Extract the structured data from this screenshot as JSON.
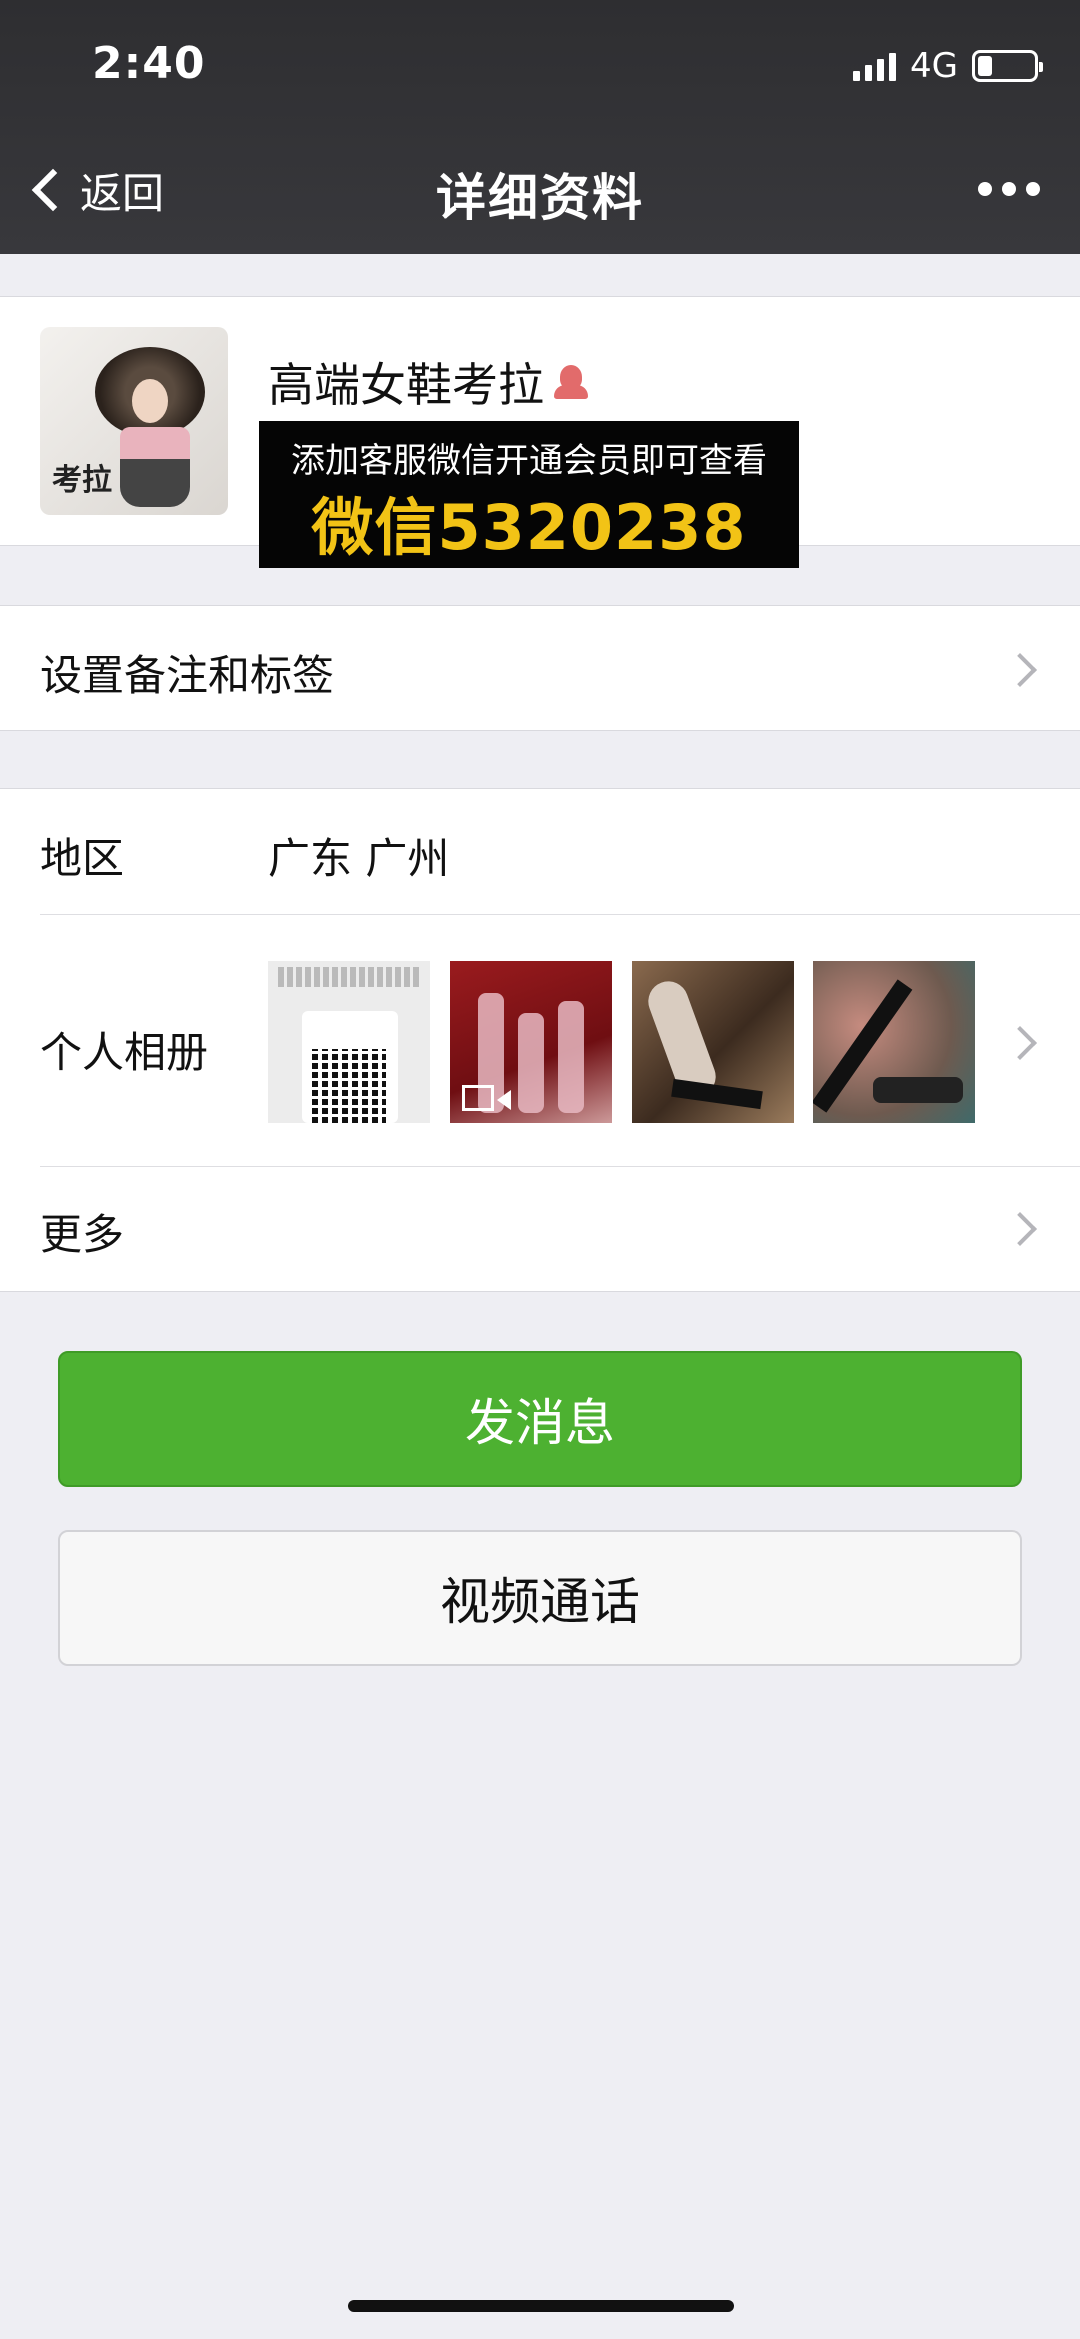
{
  "status_bar": {
    "time": "2:40",
    "network": "4G",
    "signal_bars": 4,
    "battery_level": 0.25
  },
  "nav": {
    "back_label": "返回",
    "title": "详细资料",
    "more_icon": "more-dots-icon"
  },
  "profile": {
    "name": "高端女鞋考拉",
    "avatar_text": "考拉",
    "gender_icon": "female-icon"
  },
  "promo": {
    "line1": "添加客服微信开通会员即可查看",
    "line2": "微信5320238"
  },
  "rows": {
    "remark_label": "设置备注和标签",
    "region_label": "地区",
    "region_value": "广东 广州",
    "album_label": "个人相册",
    "more_label": "更多"
  },
  "buttons": {
    "send_message": "发消息",
    "video_call": "视频通话"
  },
  "colors": {
    "header_bg": "#333336",
    "primary_green": "#4db131",
    "promo_yellow": "#f2c316",
    "page_bg": "#eeeef3"
  }
}
